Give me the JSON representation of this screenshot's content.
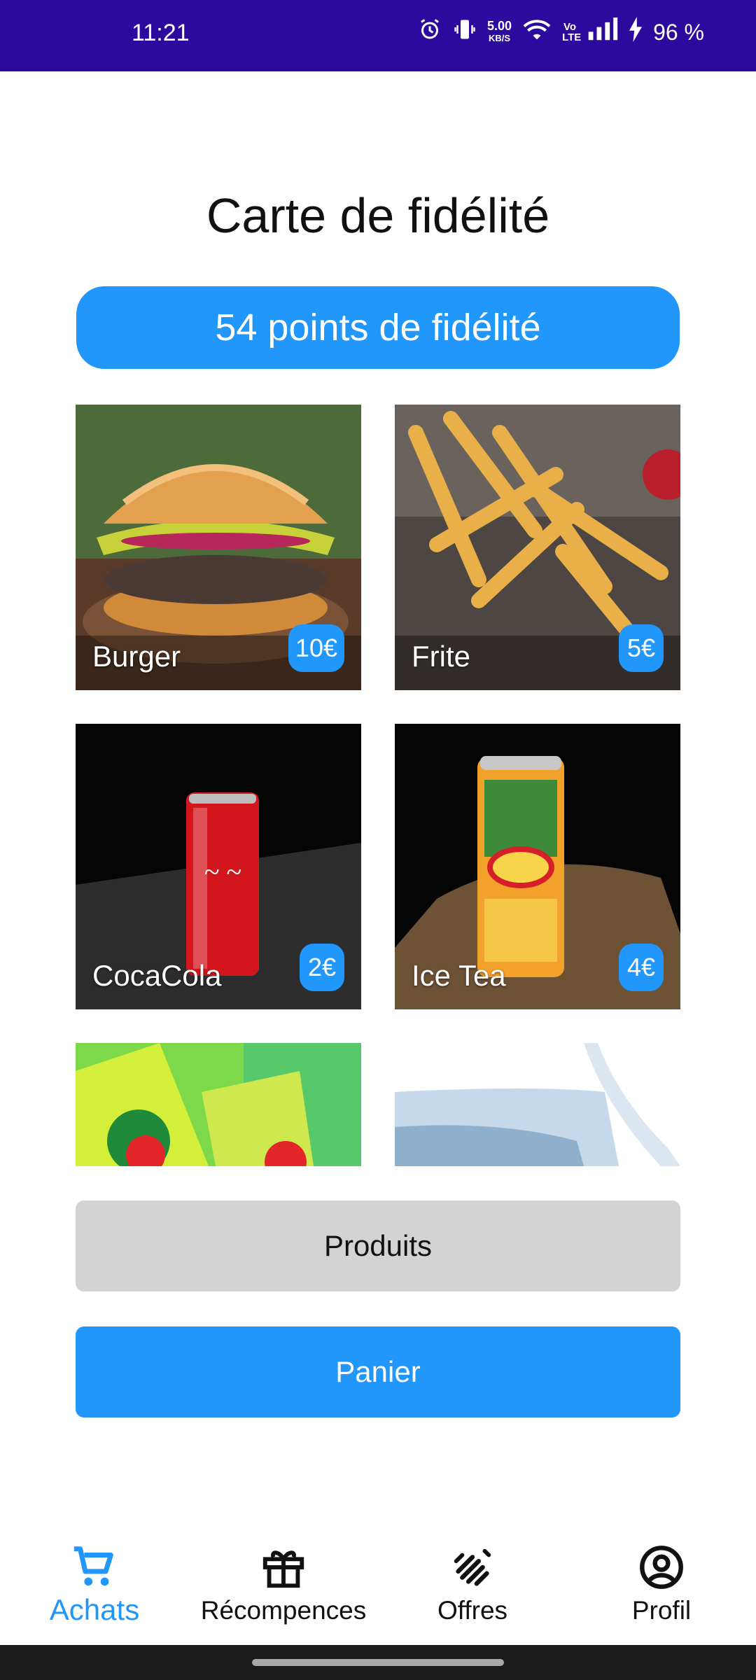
{
  "status": {
    "time": "11:21",
    "speed_value": "5.00",
    "speed_unit": "KB/S",
    "volte": "Vo LTE",
    "battery": "96 %"
  },
  "header": {
    "title": "Carte de fidélité",
    "points_label": "54 points de fidélité"
  },
  "products": [
    {
      "name": "Burger",
      "price": "10€"
    },
    {
      "name": "Frite",
      "price": "5€"
    },
    {
      "name": "CocaCola",
      "price": "2€"
    },
    {
      "name": "Ice Tea",
      "price": "4€"
    }
  ],
  "buttons": {
    "products": "Produits",
    "cart": "Panier"
  },
  "nav": [
    {
      "label": "Achats",
      "icon": "cart-icon",
      "active": true
    },
    {
      "label": "Récompences",
      "icon": "gift-icon",
      "active": false
    },
    {
      "label": "Offres",
      "icon": "offers-icon",
      "active": false
    },
    {
      "label": "Profil",
      "icon": "profile-icon",
      "active": false
    }
  ],
  "colors": {
    "accent": "#2196fb",
    "status_bar": "#2a0b9e",
    "secondary_button": "#d3d3d3"
  }
}
